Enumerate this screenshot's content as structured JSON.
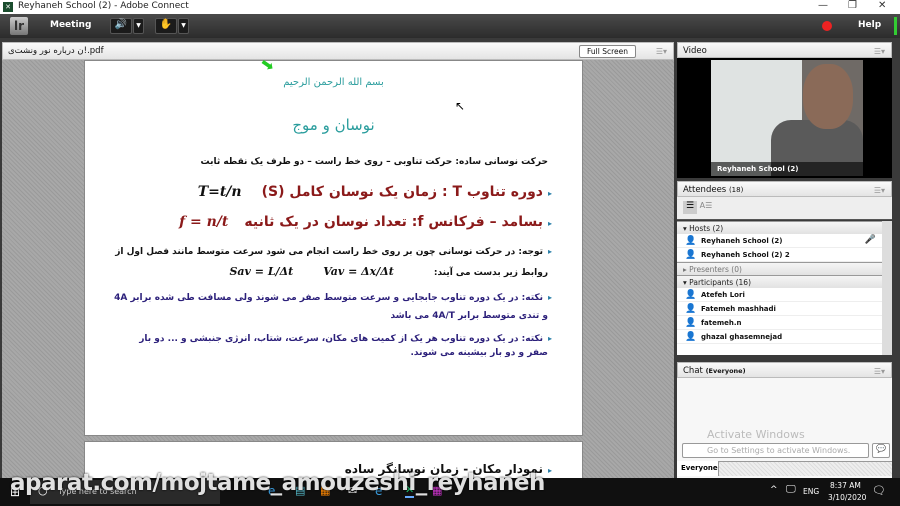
{
  "window": {
    "title": "Reyhaneh School (2) - Adobe Connect",
    "minimize": "—",
    "restore": "❐",
    "close": "✕"
  },
  "menubar": {
    "meeting": "Meeting",
    "help": "Help"
  },
  "share": {
    "filename": "ن درباره نور ونشت‌ی!.pdf",
    "fullscreen": "Full Screen"
  },
  "slide": {
    "basmala": "بسم الله الرحمن الرحیم",
    "title": "نوسان و موج",
    "intro": "حرکت نوسانی ساده: حرکت تناوبی – روی خط راست – دو طرف یک نقطه ثابت",
    "period": "دوره تناوب T : زمان یک نوسان کامل (S)",
    "period_formula": "T=t/n",
    "freq": "بسامد – فرکانس f: تعداد نوسان در یک ثانیه",
    "freq_formula": "f = n/t",
    "note1": "توجه: در حرکت نوسانی چون بر روی خط راست انجام می شود سرعت متوسط مانند فصل اول از",
    "note1b": "روابط زیر بدست می آیند:",
    "vav": "Vav = Δx/Δt",
    "sav": "Sav = L/Δt",
    "note2": "نکته: در یک دوره تناوب جابجایی و سرعت متوسط صفر می شوند ولی مسافت طی شده برابر 4A",
    "note2b": "و تندی متوسط برابر 4A/T می باشد",
    "note3": "نکته: در یک دوره تناوب هر یک از کمیت های مکان، سرعت، شتاب، انرژی جنبشی و ... دو بار",
    "note3b": "صفر و دو بار بیشینه می شوند.",
    "next": "نمودار مکان - زمان نوسانگر ساده"
  },
  "video": {
    "title": "Video",
    "name": "Reyhaneh School (2)"
  },
  "attendees": {
    "title": "Attendees",
    "count": "(18)",
    "hosts": "Hosts (2)",
    "host_list": [
      "Reyhaneh School (2)",
      "Reyhaneh School (2) 2"
    ],
    "presenters": "Presenters (0)",
    "participants": "Participants (16)",
    "participant_list": [
      "Atefeh Lori",
      "Fatemeh mashhadi",
      "fatemeh.n",
      "ghazal ghasemnejad"
    ]
  },
  "chat": {
    "title": "Chat",
    "scope": "(Everyone)",
    "tab": "Everyone",
    "watermark": "Activate Windows",
    "input_placeholder": "Go to Settings to activate Windows."
  },
  "taskbar": {
    "search": "Type here to search",
    "lang": "ENG",
    "time": "8:37 AM",
    "date": "3/10/2020"
  },
  "watermark": "aparat.com/mojtame_amouzeshi_reyhaneh",
  "colors": {
    "accent_teal": "#2a9d9d",
    "slide_red": "#8b1a1a",
    "slide_blue": "#2b1f7a"
  }
}
